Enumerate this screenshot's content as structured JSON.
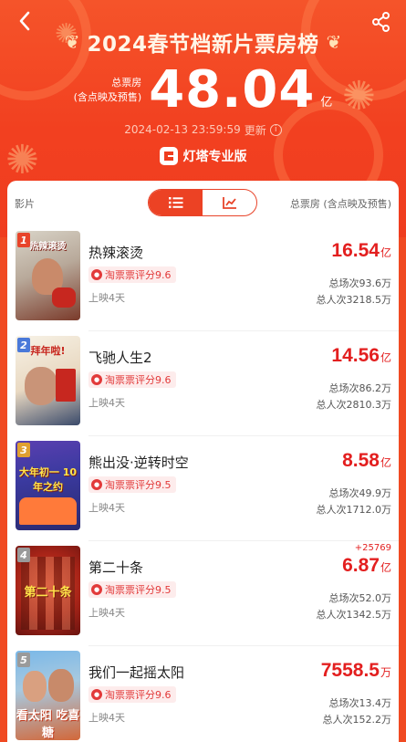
{
  "header": {
    "title": "2024春节档新片票房榜",
    "total_label_line1": "总票房",
    "total_label_line2": "(含点映及预售)",
    "total_value": "48.04",
    "total_unit": "亿",
    "updated_time": "2024-02-13 23:59:59",
    "updated_suffix": "更新",
    "info_glyph": "i",
    "brand_name": "灯塔专业版",
    "icons": [
      "back-arrow-icon",
      "share-icon",
      "laurel-icon",
      "info-icon",
      "brand-logo-icon"
    ]
  },
  "list_header": {
    "left_label": "影片",
    "right_label": "总票房 (含点映及预售)",
    "view_modes": [
      "list-icon",
      "chart-icon"
    ],
    "active_view": "list"
  },
  "colors": {
    "accent": "#ec4224",
    "value_red": "#e31f1f",
    "rating_bg": "#fdecec"
  },
  "movies": [
    {
      "rank": "1",
      "title": "热辣滚烫",
      "rating": "淘票票评分9.6",
      "days": "上映4天",
      "box_value": "16.54",
      "box_unit": "亿",
      "delta": "",
      "screenings": "总场次93.6万",
      "admissions": "总人次3218.5万",
      "poster_text": "热辣滚烫",
      "rank_color": "#e8442a"
    },
    {
      "rank": "2",
      "title": "飞驰人生2",
      "rating": "淘票票评分9.6",
      "days": "上映4天",
      "box_value": "14.56",
      "box_unit": "亿",
      "delta": "",
      "screenings": "总场次86.2万",
      "admissions": "总人次2810.3万",
      "poster_text": "拜年啦!",
      "rank_color": "#4a79d9"
    },
    {
      "rank": "3",
      "title": "熊出没·逆转时空",
      "rating": "淘票票评分9.5",
      "days": "上映4天",
      "box_value": "8.58",
      "box_unit": "亿",
      "delta": "",
      "screenings": "总场次49.9万",
      "admissions": "总人次1712.0万",
      "poster_text": "大年初一 10年之约",
      "rank_color": "#e0a030"
    },
    {
      "rank": "4",
      "title": "第二十条",
      "rating": "淘票票评分9.5",
      "days": "上映4天",
      "box_value": "6.87",
      "box_unit": "亿",
      "delta": "+25769",
      "screenings": "总场次52.0万",
      "admissions": "总人次1342.5万",
      "poster_text": "第二十条",
      "rank_color": "#9a9a9a"
    },
    {
      "rank": "5",
      "title": "我们一起摇太阳",
      "rating": "淘票票评分9.6",
      "days": "上映4天",
      "box_value": "7558.5",
      "box_unit": "万",
      "delta": "",
      "screenings": "总场次13.4万",
      "admissions": "总人次152.2万",
      "poster_text": "看太阳 吃喜糖",
      "rank_color": "#9a9a9a"
    }
  ]
}
